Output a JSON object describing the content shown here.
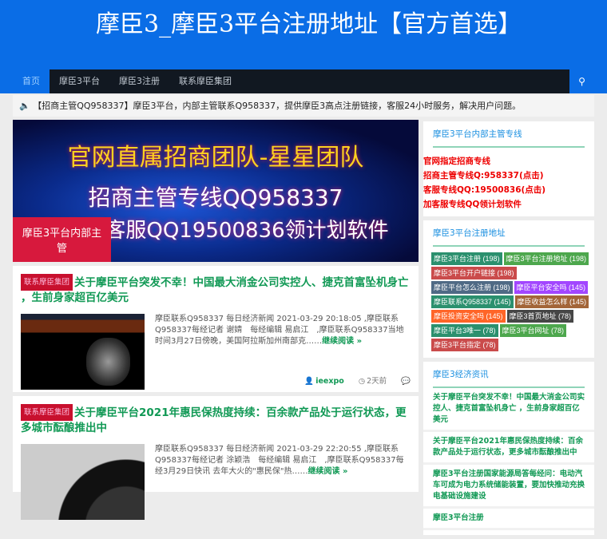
{
  "header": {
    "title": "摩臣3_摩臣3平台注册地址【官方首选】"
  },
  "nav": {
    "items": [
      "首页",
      "摩臣3平台",
      "摩臣3注册",
      "联系摩臣集团"
    ],
    "search_icon": "search-icon"
  },
  "notice": {
    "icon": "speaker-icon",
    "text": "【招商主管QQ958337】摩臣3平台，内部主管联系Q958337，提供摩臣3高点注册链接，客服24小时服务，解决用户问题。"
  },
  "banner": {
    "line1": "官网直属招商团队-星星团队",
    "line2": "招商主管专线QQ958337",
    "line3": "加专属客服QQ19500836领计划软件",
    "caption": "摩臣3平台内部主管"
  },
  "posts": [
    {
      "tag": "联系摩臣集团",
      "title": "关于摩臣平台突发不幸！中国最大消金公司实控人、捷克首富坠机身亡 ，生前身家超百亿美元",
      "excerpt": "摩臣联系Q958337 每日经济新闻 2021-03-29 20:18:05 ,摩臣联系Q958337每经记者 谢婧　每经编辑 易启江　,摩臣联系Q958337当地时间3月27日傍晚，美国阿拉斯加州南部克……",
      "more": "继续阅读 »",
      "author": "ieexpo",
      "time": "2天前"
    },
    {
      "tag": "联系摩臣集团",
      "title": "关于摩臣平台2021年惠民保热度持续：百余款产品处于运行状态，更多城市酝酿推出中",
      "excerpt": "摩臣联系Q958337 每日经济新闻 2021-03-29 22:20:55 ,摩臣联系Q958337每经记者 涂颖浩　每经编辑 易启江　,摩臣联系Q958337每经3月29日快讯 去年大火的\"惠民保\"热……",
      "more": "继续阅读 »"
    }
  ],
  "sidebar": {
    "contact": {
      "title": "摩臣3平台内部主管专线",
      "lines": [
        "官网指定招商专线",
        "招商主管专线Q:958337(点击)",
        "客服专线QQ:19500836(点击)",
        "加客服专线QQ领计划软件"
      ]
    },
    "tags": {
      "title": "摩臣3平台注册地址",
      "items": [
        {
          "label": "摩臣3平台注册 (198)",
          "color": "#15855f"
        },
        {
          "label": "摩臣3平台注册地址 (198)",
          "color": "#3a9e3a"
        },
        {
          "label": "摩臣3平台开户链接 (198)",
          "color": "#c53838"
        },
        {
          "label": "摩臣平台怎么注册 (198)",
          "color": "#3d5a78"
        },
        {
          "label": "摩臣平台安全吗 (145)",
          "color": "#9933ff"
        },
        {
          "label": "摩臣联系Q958337 (145)",
          "color": "#15855f"
        },
        {
          "label": "摩臣收益怎么样 (145)",
          "color": "#9a5523"
        },
        {
          "label": "摩臣投资安全吗 (145)",
          "color": "#ff5511"
        },
        {
          "label": "摩臣3首页地址 (78)",
          "color": "#333333"
        },
        {
          "label": "摩臣平台3唯一 (78)",
          "color": "#15855f"
        },
        {
          "label": "摩臣3平台网址 (78)",
          "color": "#3a9e3a"
        },
        {
          "label": "摩臣3平台指定 (78)",
          "color": "#c53838"
        }
      ]
    },
    "news": {
      "title": "摩臣3经济资讯",
      "items": [
        "关于摩臣平台突发不幸！中国最大消金公司实控人、捷克首富坠机身亡 ，生前身家超百亿美元",
        "关于摩臣平台2021年惠民保热度持续：百余款产品处于运行状态，更多城市酝酿推出中",
        "摩臣3平台注册国家能源局答每经问：电动汽车可成为电力系统储能装置，要加快推动充换电基础设施建设",
        "摩臣3平台注册"
      ]
    }
  }
}
